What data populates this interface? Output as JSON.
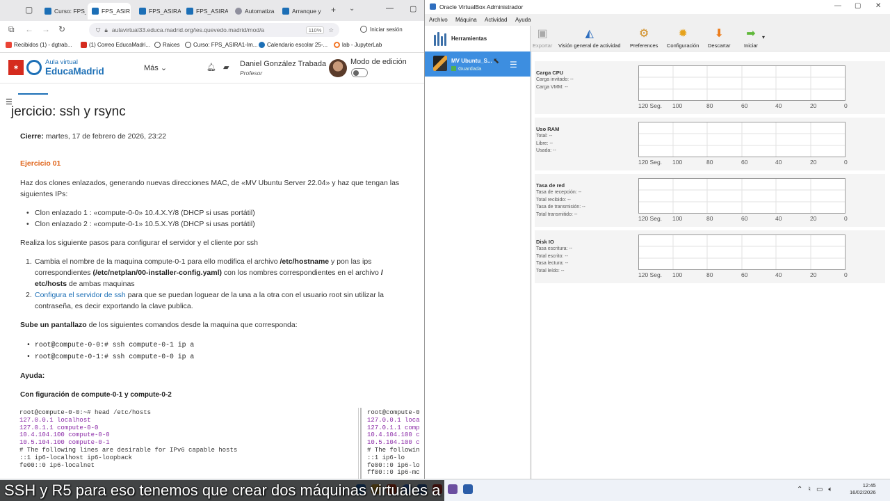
{
  "browser": {
    "tabs": [
      {
        "label": "Curso: FPS_"
      },
      {
        "label": "FPS_ASIR"
      },
      {
        "label": "FPS_ASIRA"
      },
      {
        "label": "FPS_ASIRA"
      },
      {
        "label": "Automatiza"
      },
      {
        "label": "Arranque y"
      }
    ],
    "url": "aulavirtual33.educa.madrid.org/ies.quevedo.madrid/mod/a",
    "zoom": "110%",
    "signin_label": "Iniciar sesión",
    "bookmarks": [
      {
        "label": "Recibidos (1) - dgtrab..."
      },
      {
        "label": "(1) Correo EducaMadri..."
      },
      {
        "label": "Raices"
      },
      {
        "label": "Curso: FPS_ASIRA1-Im..."
      },
      {
        "label": "Calendario escolar 25-..."
      },
      {
        "label": "lab - JupyterLab"
      }
    ]
  },
  "site": {
    "logo_line1": "Aula virtual",
    "logo_line2": "EducaMadrid",
    "more_label": "Más",
    "user_name": "Daniel González Trabada",
    "user_role": "Profesor",
    "edit_mode_label": "Modo de edición"
  },
  "page": {
    "title": "jercicio: ssh y rsync",
    "closing_label": "Cierre:",
    "closing_value": "martes, 17 de febrero de 2026, 23:22",
    "exercise_heading": "Ejercicio  01",
    "intro_line1": "Haz dos clones enlazados, generando nuevas direcciones MAC, de «MV Ubuntu Server 22.04» y haz que tengan las",
    "intro_line2": "siguientes IPs:",
    "clone1": "Clon enlazado 1 : «compute-0-0» 10.4.X.Y/8 (DHCP si usas portátil)",
    "clone2": "Clon enlazado 2 : «compute-0-1» 10.5.X.Y/8 (DHCP si usas portátil)",
    "steps_intro": "Realiza los siguiente pasos para configurar el servidor y el cliente por ssh",
    "step1_a": "Cambia el nombre de la maquina compute-0-1 para ello modifica el archivo ",
    "step1_b": "/etc/hostname",
    "step1_c": " y pon las ips",
    "step1_d": "correspondientes ",
    "step1_e": "(/etc/netplan/00-installer-config.yaml)",
    "step1_f": " con los nombres correspondientes en el archivo ",
    "step1_g": "/",
    "step1_h": "etc/hosts",
    "step1_i": " de ambas maquinas",
    "step2_link": "Configura el servidor de ssh",
    "step2_rest": " para que se puedan loguear de la una a la otra con el usuario root sin utilizar la",
    "step2_line2": "contraseña, es decir exportando la clave publica.",
    "screenshot_a": "Sube un pantallazo",
    "screenshot_b": " de los siguientes comandos desde la maquina que corresponda:",
    "cmd1": "root@compute-0-0:# ssh compute-0-1 ip a",
    "cmd2": "root@compute-0-1:# ssh compute-0-0 ip a",
    "help_label": "Ayuda:",
    "config_label": "Con figuración de compute-0-1 y compute-0-2",
    "code_left": [
      {
        "text": "root@compute-0-0:~# head /etc/hosts",
        "cls": ""
      },
      {
        "text": "127.0.0.1 localhost",
        "cls": "purple"
      },
      {
        "text": "127.0.1.1 compute-0-0",
        "cls": "purple"
      },
      {
        "text": "10.4.104.100 compute-0-0",
        "cls": "purple"
      },
      {
        "text": "10.5.104.100 compute-0-1",
        "cls": "purple"
      },
      {
        "text": " ",
        "cls": ""
      },
      {
        "text": "# The following lines are desirable for IPv6 capable hosts",
        "cls": ""
      },
      {
        "text": "::1     ip6-localhost ip6-loopback",
        "cls": ""
      },
      {
        "text": "fe00::0 ip6-localnet",
        "cls": ""
      }
    ],
    "code_right": [
      {
        "text": "root@compute-0",
        "cls": ""
      },
      {
        "text": "127.0.0.1 loca",
        "cls": "purple"
      },
      {
        "text": "127.0.1.1 comp",
        "cls": "purple"
      },
      {
        "text": "10.4.104.100 c",
        "cls": "purple"
      },
      {
        "text": "10.5.104.100 c",
        "cls": "purple"
      },
      {
        "text": "# The followin",
        "cls": ""
      },
      {
        "text": "::1     ip6-lo",
        "cls": ""
      },
      {
        "text": "fe00::0 ip6-lo",
        "cls": ""
      },
      {
        "text": "ff00::0 ip6-mc",
        "cls": ""
      }
    ]
  },
  "vbox": {
    "title": "Oracle VirtualBox Administrador",
    "menu": [
      "Archivo",
      "Máquina",
      "Actividad",
      "Ayuda"
    ],
    "tools_label": "Herramientas",
    "vm_name": "MV Ubuntu_S...",
    "vm_state": "Guardada",
    "toolbar": [
      {
        "label": "Exportar",
        "icon": "export-icon"
      },
      {
        "label": "Visión general de actividad",
        "icon": "activity-icon"
      },
      {
        "label": "Preferences",
        "icon": "preferences-icon"
      },
      {
        "label": "Configuración",
        "icon": "settings-gear-icon"
      },
      {
        "label": "Descartar",
        "icon": "discard-arrow-icon"
      },
      {
        "label": "Iniciar",
        "icon": "start-arrow-icon"
      }
    ],
    "axis_labels": [
      "120 Seg.",
      "100",
      "80",
      "60",
      "40",
      "20",
      "0"
    ],
    "panels": [
      {
        "title": "Carga CPU",
        "lines": [
          "Carga invitado: --",
          "Carga VMM: --"
        ]
      },
      {
        "title": "Uso RAM",
        "lines": [
          "Total: --",
          "Libre: --",
          "Usada: --"
        ]
      },
      {
        "title": "Tasa de red",
        "lines": [
          "Tasa de recepción: --",
          "Total recibido: --",
          "Tasa de transmisión: --",
          "Total transmitido: --"
        ]
      },
      {
        "title": "Disk IO",
        "lines": [
          "Tasa escritura: --",
          "Total escrito: --",
          "Tasa lectura: --",
          "Total leído: --"
        ]
      }
    ]
  },
  "caption": "SSH y R5 para eso tenemos que crear dos máquinas virtuales a",
  "clock": {
    "time": "12:45",
    "date": "16/02/2026"
  }
}
